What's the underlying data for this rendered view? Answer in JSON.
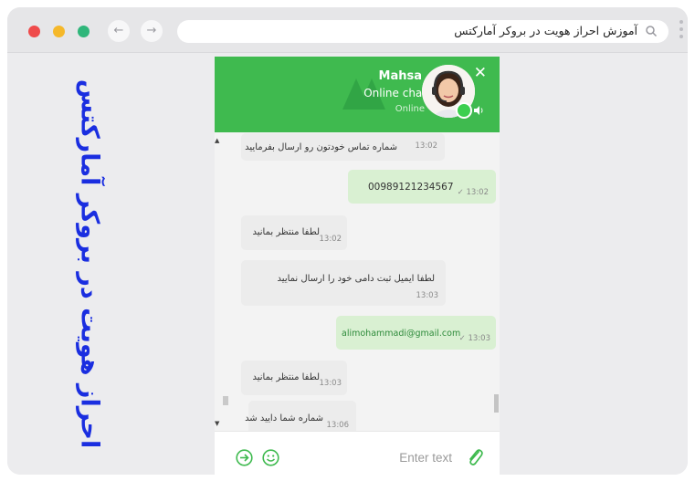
{
  "browser": {
    "url_text": "آموزش احراز هویت در بروکر آمارکتس",
    "back_icon": "←",
    "forward_icon": "→"
  },
  "page": {
    "vertical_title": "احراز هویت در بروکر آمارکتس"
  },
  "chat": {
    "header": {
      "agent_name": "Mahsa",
      "subtitle": "Online chat",
      "status": "Online",
      "close_icon": "✕"
    },
    "messages": [
      {
        "direction": "in",
        "text": "شماره تماس خودتون رو ارسال بفرمایید",
        "time": "13:02"
      },
      {
        "direction": "out",
        "text": "00989121234567",
        "time": "13:02"
      },
      {
        "direction": "in",
        "text": "لطفا منتظر بمانید",
        "time": "13:02"
      },
      {
        "direction": "in",
        "text": "لطفا ایمیل ثبت دامی خود را ارسال نمایید",
        "time": "13:03"
      },
      {
        "direction": "out",
        "text": "alimohammadi@gmail.com",
        "time": "13:03"
      },
      {
        "direction": "in",
        "text": "لطفا منتظر بمانید",
        "time": "13:03"
      },
      {
        "direction": "in",
        "text": "شماره شما دایید شد",
        "time": "13:06"
      }
    ],
    "composer": {
      "placeholder": "Enter text"
    }
  },
  "colors": {
    "header_green": "#3fba4f",
    "title_blue": "#1a2ee0",
    "outgoing_bubble": "#d9f0d2",
    "incoming_bubble": "#ececec"
  }
}
